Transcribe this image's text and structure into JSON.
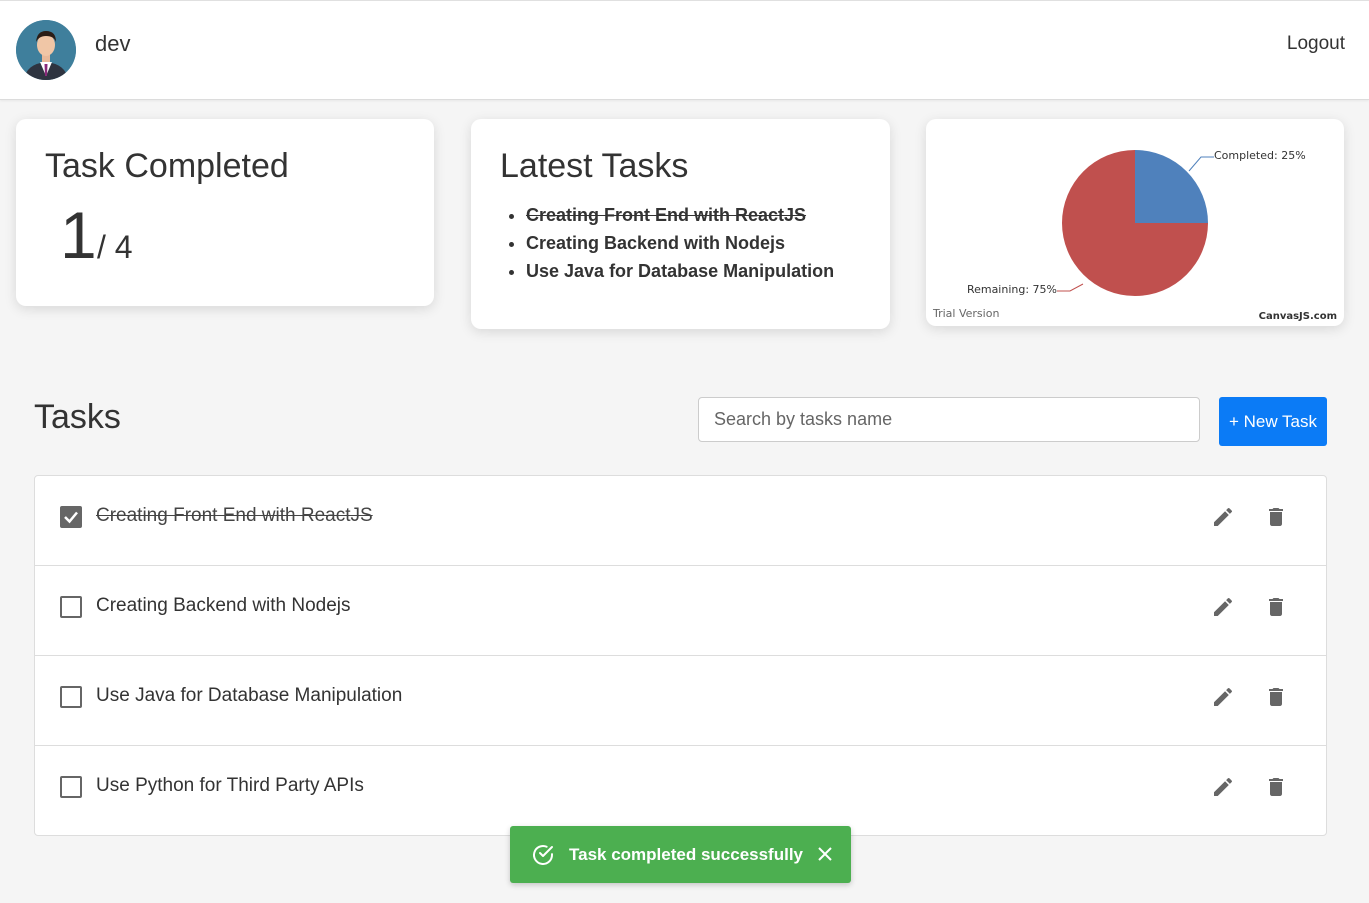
{
  "header": {
    "username": "dev",
    "logout_label": "Logout"
  },
  "summary": {
    "title": "Task Completed",
    "completed": "1",
    "total": "/ 4"
  },
  "latest": {
    "title": "Latest Tasks",
    "items": [
      {
        "label": "Creating Front End with ReactJS",
        "done": true
      },
      {
        "label": "Creating Backend with Nodejs",
        "done": false
      },
      {
        "label": "Use Java for Database Manipulation",
        "done": false
      }
    ]
  },
  "chart_data": {
    "type": "pie",
    "labels": [
      "Completed",
      "Remaining"
    ],
    "values": [
      25,
      75
    ],
    "label_texts": [
      "Completed: 25%",
      "Remaining: 75%"
    ],
    "colors": [
      "#4f81bc",
      "#c0504e"
    ],
    "watermark_left": "Trial Version",
    "watermark_right": "CanvasJS.com"
  },
  "tasks": {
    "title": "Tasks",
    "search_placeholder": "Search by tasks name",
    "new_task_label": "+ New Task",
    "items": [
      {
        "label": "Creating Front End with ReactJS",
        "done": true
      },
      {
        "label": "Creating Backend with Nodejs",
        "done": false
      },
      {
        "label": "Use Java for Database Manipulation",
        "done": false
      },
      {
        "label": "Use Python for Third Party APIs",
        "done": false
      }
    ]
  },
  "toast": {
    "message": "Task completed successfully",
    "color": "#4caf50"
  }
}
